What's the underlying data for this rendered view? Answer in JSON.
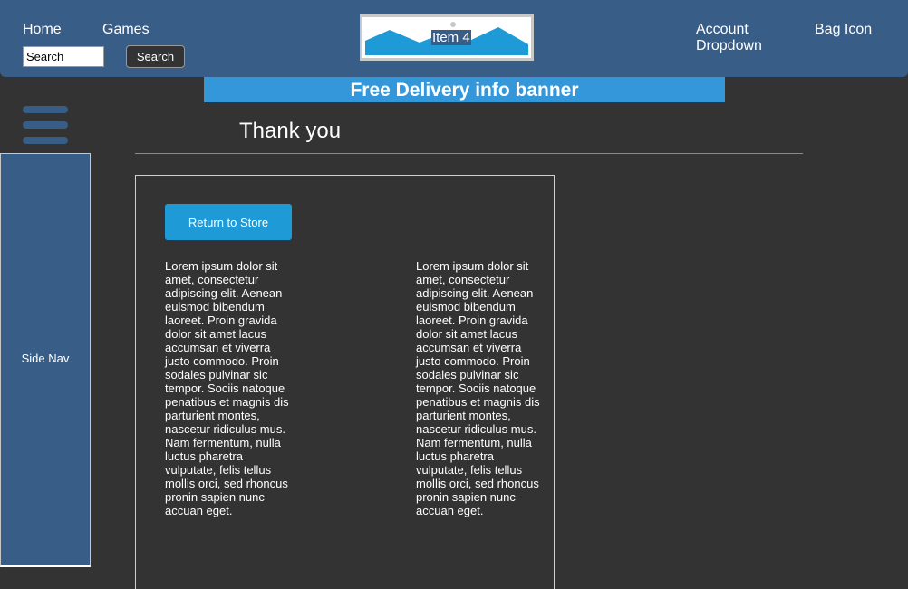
{
  "header": {
    "nav": {
      "home_label": "Home",
      "games_label": "Games",
      "account_label": "Account Dropdown",
      "bag_label": "Bag Icon"
    },
    "search": {
      "placeholder": "Search",
      "value": "",
      "button_label": "Search"
    },
    "logo": {
      "label": "Item 4",
      "colors": {
        "frame": "#c8c8c8",
        "mountains": "#1e9ad6"
      }
    }
  },
  "banner": {
    "text": "Free Delivery info banner",
    "color": "#3497d9"
  },
  "side_nav": {
    "label": "Side Nav",
    "menu_icon": "hamburger-menu-icon",
    "color": "#385d87"
  },
  "main": {
    "title": "Thank you",
    "return_button_label": "Return to Store",
    "columns": [
      {
        "text": "Lorem ipsum dolor sit amet, consectetur adipiscing elit. Aenean euismod bibendum laoreet. Proin gravida dolor sit amet lacus accumsan et viverra justo commodo. Proin sodales pulvinar sic tempor. Sociis natoque penatibus et magnis dis parturient montes, nascetur ridiculus mus. Nam fermentum, nulla luctus pharetra vulputate, felis tellus mollis orci, sed rhoncus pronin sapien nunc accuan eget."
      },
      {
        "text": "Lorem ipsum dolor sit amet, consectetur adipiscing elit. Aenean euismod bibendum laoreet. Proin gravida dolor sit amet lacus accumsan et viverra justo commodo. Proin sodales pulvinar sic tempor. Sociis natoque penatibus et magnis dis parturient montes, nascetur ridiculus mus. Nam fermentum, nulla luctus pharetra vulputate, felis tellus mollis orci, sed rhoncus pronin sapien nunc accuan eget."
      }
    ]
  },
  "colors": {
    "header_bg": "#385d87",
    "page_bg": "#333333",
    "accent": "#1e9ad6",
    "text": "#ffffff"
  }
}
